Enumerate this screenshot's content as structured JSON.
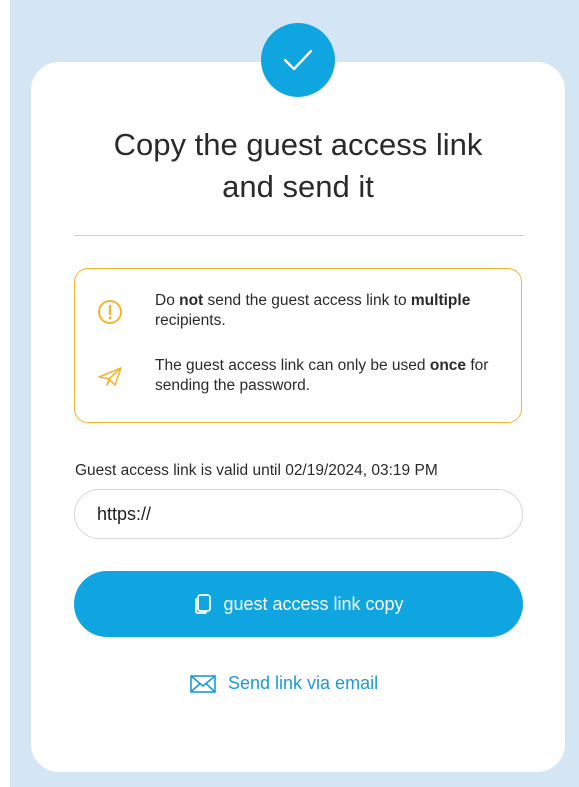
{
  "dialog": {
    "title_line1": "Copy the guest access link",
    "title_line2": "and send it"
  },
  "warnings": [
    {
      "icon": "exclamation-circle-icon",
      "text_before": "Do ",
      "text_bold": "not",
      "text_middle": " send the guest access link to ",
      "text_bold2": "multiple",
      "text_after": " recipients."
    },
    {
      "icon": "paper-plane-icon",
      "text_before": "The guest access link can only be used ",
      "text_bold": "once",
      "text_after": " for sending the password."
    }
  ],
  "link": {
    "validity_text": "Guest access link is valid until 02/19/2024, 03:19 PM",
    "value": "https://"
  },
  "actions": {
    "copy_label": "guest access link copy",
    "email_label": "Send link via email"
  },
  "colors": {
    "accent": "#0ea5e0",
    "warning": "#f2b530",
    "backdrop": "#d4e6f4",
    "link": "#1b9ad6"
  }
}
